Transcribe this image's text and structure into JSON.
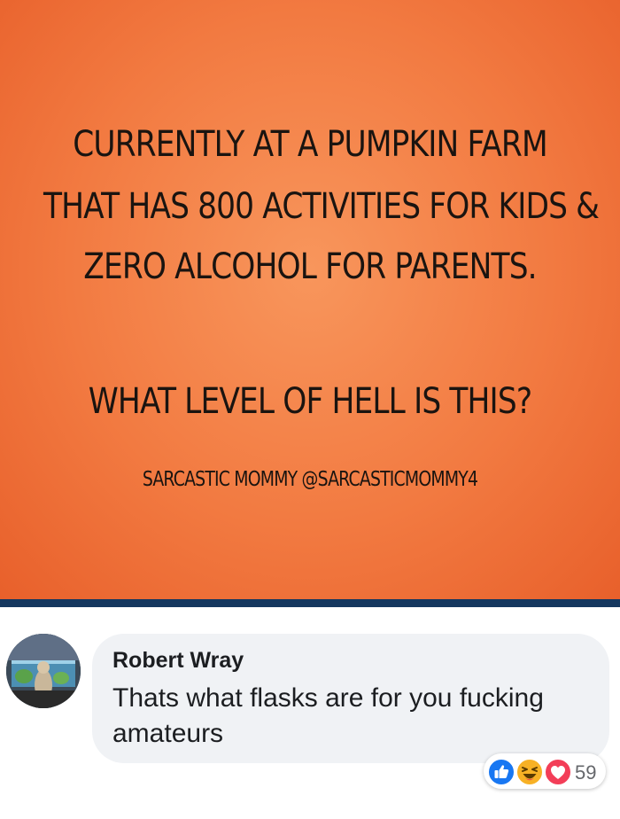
{
  "poster": {
    "line1": "CURRENTLY AT A PUMPKIN FARM",
    "line2": "THAT HAS 800 ACTIVITIES FOR KIDS &",
    "line3": "ZERO ALCOHOL FOR PARENTS.",
    "line4": "WHAT LEVEL OF HELL IS THIS?",
    "credit": "SARCASTIC MOMMY @SARCASTICMOMMY4",
    "background_color": "#f27a41"
  },
  "comment": {
    "author": "Robert Wray",
    "text": "Thats what flasks are for you fucking amateurs",
    "reactions": {
      "icons": [
        "like-icon",
        "haha-icon",
        "love-icon"
      ],
      "count": "59"
    }
  },
  "colors": {
    "divider": "#15375f",
    "like": "#1877f2",
    "haha": "#f7b125",
    "love": "#f33e58",
    "bubble": "#f0f2f5"
  }
}
